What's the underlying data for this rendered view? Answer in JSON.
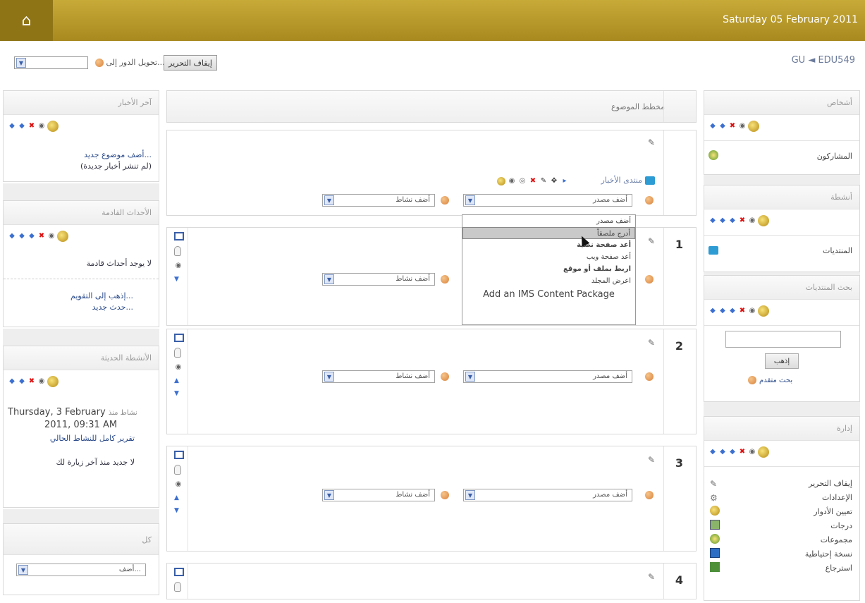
{
  "header": {
    "home_icon": "home-icon",
    "date": "Saturday 05 February 2011"
  },
  "subbar": {
    "breadcrumb": "GU ◄ EDU549",
    "role_label": "تحويل الدور إلى...",
    "edit_button": "إيقاف التحرير"
  },
  "left": {
    "news": {
      "title": "آخر الأخبار",
      "links": [
        "أضف موضوع جديد...",
        "(لم تنشر أخبار جديدة)"
      ]
    },
    "events": {
      "title": "الأحداث القادمة",
      "empty": "لا يوجد أحداث قادمة",
      "links": [
        "إذهب إلى التقويم...",
        "حدث جديد..."
      ]
    },
    "recent": {
      "title": "الأنشطة الحديثة",
      "since_label": "نشاط منذ",
      "date1": "Thursday, 3 February",
      "date2": "2011, 09:31 AM",
      "full_report": "تقرير كامل للنشاط الحالي",
      "nothing": "لا جديد منذ آخر زيارة لك"
    },
    "search_block": {
      "title": "كل",
      "select": "أضف..."
    }
  },
  "center": {
    "title": "مخطط الموضوع",
    "forum_label": "منتدى الأخبار",
    "add_resource": "أضف مصدر",
    "add_activity": "أضف نشاط",
    "section_numbers": [
      "1",
      "2",
      "3",
      "4"
    ],
    "dropdown": [
      "أضف مصدر",
      "أدرج ملصقاً",
      "أعد صفحة نصية",
      "أعد صفحة ويب",
      "اربط بملف أو موقع",
      "اعرض المجلد",
      "Add an IMS Content Package"
    ]
  },
  "right": {
    "people": {
      "title": "أشخاص",
      "participants": "المشاركون"
    },
    "activities": {
      "title": "أنشطة",
      "forums": "المنتديات"
    },
    "forum_search": {
      "title": "بحث المنتديات",
      "go": "إذهب",
      "advanced": "بحث متقدم"
    },
    "admin": {
      "title": "إدارة",
      "items": [
        "إيقاف التحرير",
        "الإعدادات",
        "تعيين الأدوار",
        "درجات",
        "مجموعات",
        "نسخة إحتياطية",
        "استرجاع"
      ]
    }
  }
}
